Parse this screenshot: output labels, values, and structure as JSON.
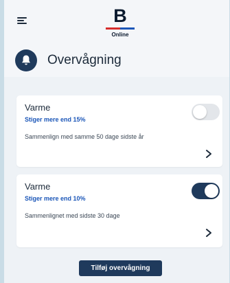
{
  "header": {
    "logo_letter": "B",
    "logo_sub": "Online",
    "title": "Overvågning"
  },
  "colors": {
    "accent": "#1b56b8",
    "primary": "#1f3a5c",
    "brand_red": "#d62c2c"
  },
  "icons": {
    "menu": "hamburger-menu-icon",
    "title": "bell-icon",
    "chevron": "chevron-right-icon"
  },
  "monitors": [
    {
      "title": "Varme",
      "condition": "Stiger mere end 15%",
      "description": "Sammenlign med samme 50 dage sidste år",
      "enabled": false
    },
    {
      "title": "Varme",
      "condition": "Stiger mere end 10%",
      "description": "Sammenlignet med sidste 30 dage",
      "enabled": true
    }
  ],
  "actions": {
    "add_label": "Tilføj overvågning"
  }
}
